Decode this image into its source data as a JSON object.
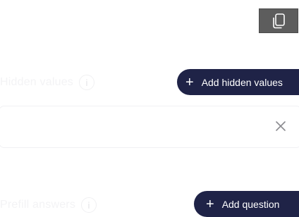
{
  "toolbar": {
    "copy_icon": "copy-icon"
  },
  "hidden_values": {
    "label": "Hidden values",
    "info_icon": "i",
    "add_label": "Add hidden values",
    "add_icon": "+",
    "row_remove_icon": "close-icon"
  },
  "prefill": {
    "label": "Prefill answers",
    "info_icon": "i",
    "add_label": "Add question",
    "add_icon": "+"
  },
  "colors": {
    "button_bg": "#1f2347",
    "copy_bg": "#5d5d5d"
  }
}
